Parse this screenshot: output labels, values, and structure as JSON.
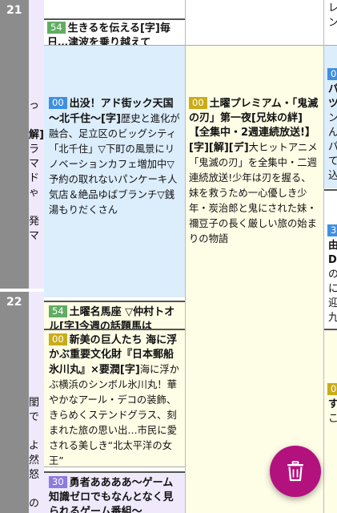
{
  "hours": [
    {
      "label": "21"
    },
    {
      "label": "22"
    }
  ],
  "left_column": {
    "fragments_21": [
      "っ",
      "解]",
      "ラ",
      "マ",
      "ド",
      "ゃ",
      "発",
      "マ"
    ],
    "fragments_22": [
      "閨",
      "で",
      "よ",
      "然",
      "怒",
      "の"
    ]
  },
  "programs": [
    {
      "badge": "54",
      "title": "生きるを伝える[字]毎日…津波を乗り越えて",
      "desc": ""
    },
    {
      "badge": "00",
      "title": "出没！アド街ック天国 〜北千住〜[字]",
      "desc": "歴史と進化が融合、足立区のビッグシティ「北千住」▽下町の風景にリノベーションカフェ増加中▽予約の取れないパンケーキ人気店＆絶品ゆばブランチ▽銭湯もりだくさん"
    },
    {
      "badge": "54",
      "title": "土曜名馬座 ▽仲村トオル[字]今週の話題馬は",
      "desc": ""
    },
    {
      "badge": "00",
      "title": "新美の巨人たち 海に浮かぶ重要文化財『日本郵船氷川丸』×要潤[字]",
      "desc": "海に浮かぶ横浜のシンボル氷川丸！華やかなアール・デコの装飾、きらめくステンドグラス、刻まれた旅の思い出…市民に愛される美しき“北太平洋の女王”"
    },
    {
      "badge": "30",
      "title": "勇者ああああ〜ゲーム知識ゼロでもなんとなく見られるゲーム番組〜",
      "desc": ""
    },
    {
      "badge": "00",
      "title": "土曜プレミアム・「鬼滅の刃」第一夜[兄妹の絆]【全集中・2週連続放送!】[字][解][デ]",
      "desc": "大ヒットアニメ「鬼滅の刃」を全集中・二週連続放送!少年は刃を握る、妹を救うため一心優しき少年・炭治郎と鬼にされた妹・禰豆子の長く厳しい旅の始まりの物語"
    }
  ],
  "right_column": {
    "frag_top": [
      "レ",
      "ン"
    ],
    "frag_mid": [
      "00",
      "パ",
      "ツ",
      "ン",
      "ん",
      "パ",
      "て",
      "込"
    ],
    "frag_low": [
      "3",
      "由",
      "D",
      "の",
      "に",
      "迎",
      "九"
    ],
    "frag_bottom": [
      "0",
      "す",
      "こ"
    ]
  },
  "fab": {
    "icon": "trash-icon"
  },
  "colors": {
    "hour_bg": "#8c8c8c",
    "blue_cell": "#dcedfc",
    "yellow_cell": "#fefde6",
    "purple_cell": "#efe9fb",
    "fab": "#b3117e",
    "badge_blue": "#3f8fe0",
    "badge_green": "#5fae62",
    "badge_yellow": "#c9ac1a",
    "badge_purple": "#8f7ae0"
  }
}
